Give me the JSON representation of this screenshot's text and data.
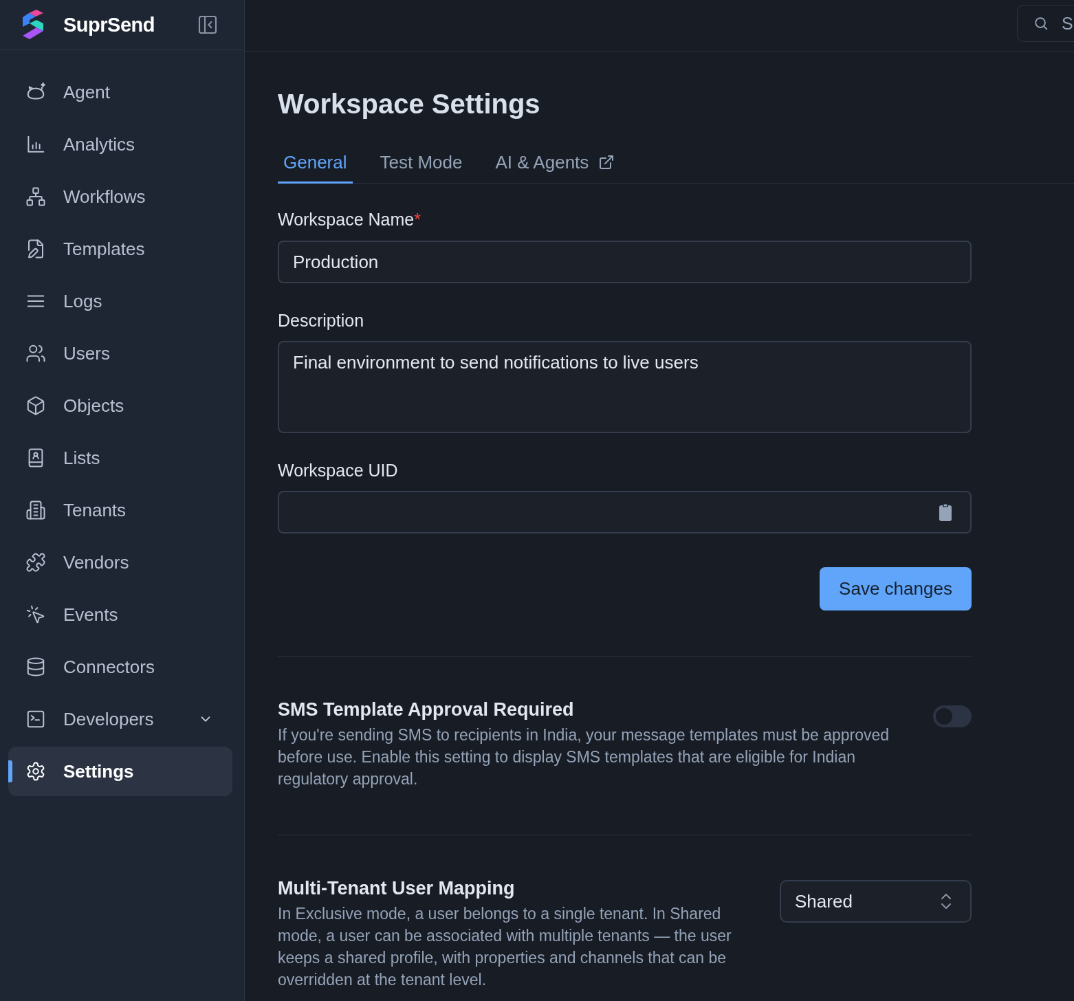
{
  "sidebar": {
    "brand": "SuprSend",
    "items": [
      {
        "label": "Agent",
        "selected": false,
        "expandable": false
      },
      {
        "label": "Analytics",
        "selected": false,
        "expandable": false
      },
      {
        "label": "Workflows",
        "selected": false,
        "expandable": false
      },
      {
        "label": "Templates",
        "selected": false,
        "expandable": false
      },
      {
        "label": "Logs",
        "selected": false,
        "expandable": false
      },
      {
        "label": "Users",
        "selected": false,
        "expandable": false
      },
      {
        "label": "Objects",
        "selected": false,
        "expandable": false
      },
      {
        "label": "Lists",
        "selected": false,
        "expandable": false
      },
      {
        "label": "Tenants",
        "selected": false,
        "expandable": false
      },
      {
        "label": "Vendors",
        "selected": false,
        "expandable": false
      },
      {
        "label": "Events",
        "selected": false,
        "expandable": false
      },
      {
        "label": "Connectors",
        "selected": false,
        "expandable": false
      },
      {
        "label": "Developers",
        "selected": false,
        "expandable": true
      },
      {
        "label": "Settings",
        "selected": true,
        "expandable": false
      }
    ]
  },
  "topbar": {
    "search": {
      "placeholder": "S"
    }
  },
  "page": {
    "title": "Workspace Settings",
    "tabs": [
      {
        "label": "General",
        "selected": true,
        "external": false
      },
      {
        "label": "Test Mode",
        "selected": false,
        "external": false
      },
      {
        "label": "AI & Agents",
        "selected": false,
        "external": true
      }
    ]
  },
  "form": {
    "fields": [
      {
        "kind": "input",
        "label": "Workspace Name",
        "required_mark": "*",
        "value": "Production"
      },
      {
        "kind": "textarea",
        "label": "Description",
        "value": "Final environment to send notifications to live users"
      },
      {
        "kind": "copy",
        "label": "Workspace UID"
      }
    ],
    "save_button": "Save changes"
  },
  "settings": [
    {
      "kind": "toggle",
      "title": "SMS Template Approval Required",
      "description": "If you're sending SMS to recipients in India, your message templates must be approved before use. Enable this setting to display SMS templates that are eligible for Indian regulatory approval.",
      "on": false
    },
    {
      "kind": "select",
      "title": "Multi-Tenant User Mapping",
      "description": "In Exclusive mode, a user belongs to a single tenant. In Shared mode, a user can be associated with multiple tenants — the user keeps a shared profile, with properties and channels that can be overridden at the tenant level.",
      "value": "Shared"
    }
  ]
}
